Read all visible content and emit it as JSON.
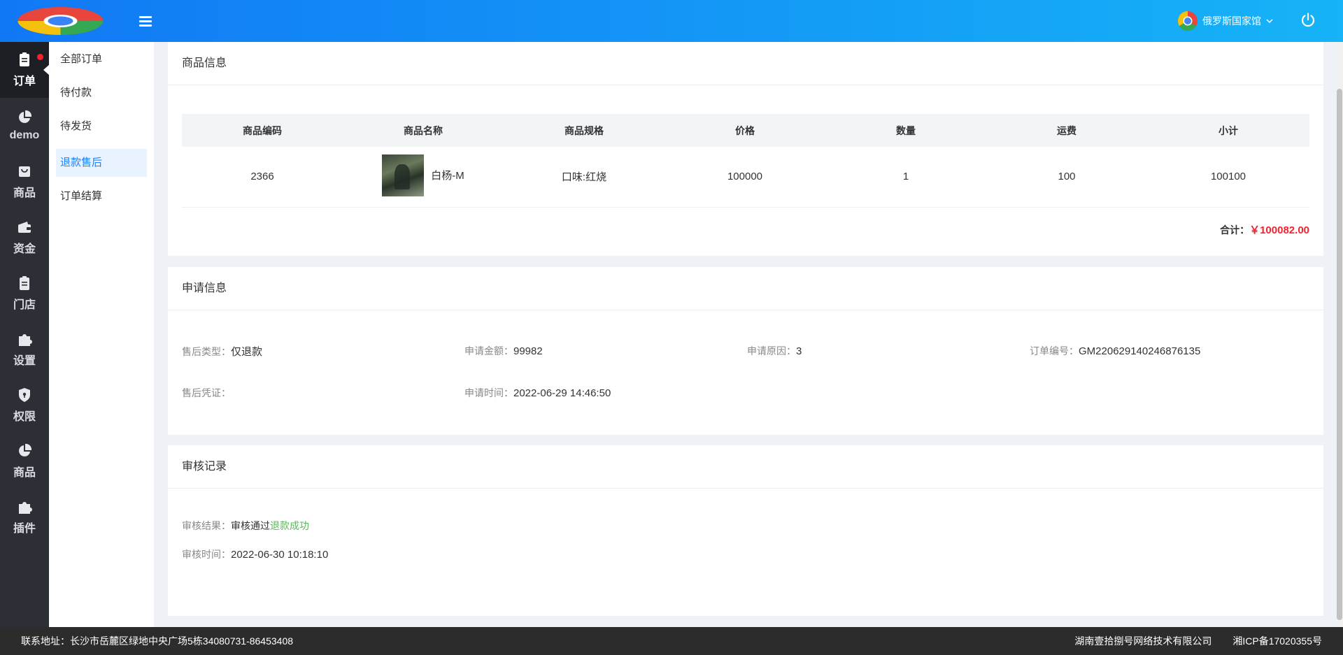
{
  "header": {
    "store_name": "俄罗斯国家馆",
    "brand_color": "#1178f5"
  },
  "rail": {
    "items": [
      {
        "label": "订单",
        "icon": "clipboard-icon"
      },
      {
        "label": "demo",
        "icon": "pie-chart-icon"
      },
      {
        "label": "商品",
        "icon": "bag-icon"
      },
      {
        "label": "资金",
        "icon": "wallet-icon"
      },
      {
        "label": "门店",
        "icon": "clipboard-icon"
      },
      {
        "label": "设置",
        "icon": "puzzle-icon"
      },
      {
        "label": "权限",
        "icon": "shield-icon"
      },
      {
        "label": "商品",
        "icon": "pie-chart-icon"
      },
      {
        "label": "插件",
        "icon": "puzzle-icon"
      }
    ]
  },
  "subnav": {
    "items": [
      {
        "label": "全部订单"
      },
      {
        "label": "待付款"
      },
      {
        "label": "待发货"
      },
      {
        "label": "退款售后"
      },
      {
        "label": "订单结算"
      }
    ]
  },
  "goods": {
    "title": "商品信息",
    "columns": [
      "商品编码",
      "商品名称",
      "商品规格",
      "价格",
      "数量",
      "运费",
      "小计"
    ],
    "row": {
      "code": "2366",
      "name": "白杨-M",
      "spec": "口味:红烧",
      "price": "100000",
      "qty": "1",
      "freight": "100",
      "subtotal": "100100"
    },
    "total_label": "合计：",
    "total_value": "￥100082.00"
  },
  "apply": {
    "title": "申请信息",
    "type_label": "售后类型：",
    "type_value": "仅退款",
    "amount_label": "申请金额：",
    "amount_value": "99982",
    "reason_label": "申请原因：",
    "reason_value": "3",
    "order_label": "订单编号：",
    "order_value": "GM220629140246876135",
    "proof_label": "售后凭证：",
    "time_label": "申请时间：",
    "time_value": "2022-06-29 14:46:50"
  },
  "audit": {
    "title": "审核记录",
    "result_label": "审核结果：",
    "result_value": "审核通过",
    "result_status": "退款成功",
    "time_label": "审核时间：",
    "time_value": "2022-06-30 10:18:10"
  },
  "footer": {
    "address": "联系地址：长沙市岳麓区绿地中央广场5栋34080731-86453408",
    "company": "湖南壹拾捌号网络技术有限公司",
    "icp": "湘ICP备17020355号"
  }
}
